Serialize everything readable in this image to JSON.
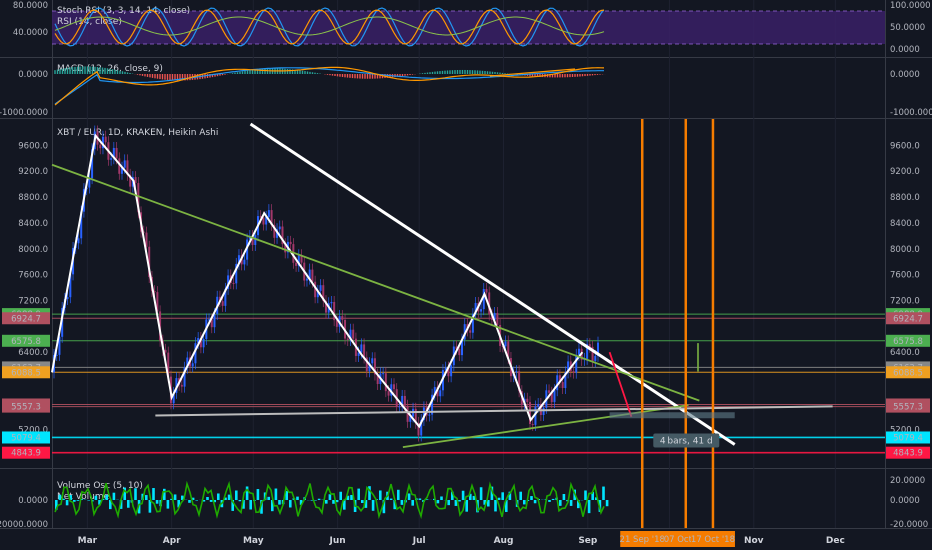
{
  "chart_data": {
    "type": "candlestick",
    "title": "XBT / EUR, 1D, KRAKEN, Heikin Ashi",
    "x_months": [
      "Mar",
      "Apr",
      "May",
      "Jun",
      "Jul",
      "Aug",
      "Sep",
      "Oct",
      "Nov",
      "Dec"
    ],
    "date_marker_labels": [
      "21 Sep '18",
      "07 Oct '18",
      "17 Oct '18"
    ],
    "price_axis": {
      "ticks": [
        9600,
        9200,
        8800,
        8400,
        8000,
        7600,
        7200,
        6400,
        5200
      ],
      "ylim": [
        4700,
        9900
      ],
      "left_ticks": [
        9600,
        9200,
        8800,
        8400,
        8000,
        7600,
        7200,
        6400,
        5200
      ]
    },
    "horizontal_levels": [
      {
        "value": "6988.9",
        "color": "#4caf50"
      },
      {
        "value": "6924.7",
        "color": "#b05060"
      },
      {
        "value": "6575.8",
        "color": "#4caf50"
      },
      {
        "value": "6163.7",
        "color": "#888888"
      },
      {
        "value": "6088.5",
        "color": "#f0a020"
      },
      {
        "value": "5590.1",
        "color": "#b05060"
      },
      {
        "value": "5557.3",
        "color": "#b05060"
      },
      {
        "value": "5079.4",
        "color": "#00e5ff"
      },
      {
        "value": "4843.9",
        "color": "#ff1744"
      }
    ],
    "price_path": [
      {
        "date": "Feb 16",
        "price": 6088
      },
      {
        "date": "Mar 4",
        "price": 9750
      },
      {
        "date": "Mar 18",
        "price": 9050
      },
      {
        "date": "Apr 1",
        "price": 5700
      },
      {
        "date": "May 5",
        "price": 8550
      },
      {
        "date": "Jun 10",
        "price": 6350
      },
      {
        "date": "Jul 1",
        "price": 5250
      },
      {
        "date": "Jul 25",
        "price": 7300
      },
      {
        "date": "Aug 11",
        "price": 5350
      },
      {
        "date": "Aug 30",
        "price": 6400
      }
    ],
    "trendlines": [
      {
        "name": "white-descending",
        "color": "#ffffff",
        "points": [
          [
            "Apr 30",
            9930
          ],
          [
            "Oct 25",
            4970
          ]
        ]
      },
      {
        "name": "green-descending",
        "color": "#7cb342",
        "points": [
          [
            "Feb 16",
            9300
          ],
          [
            "Oct 12",
            5650
          ]
        ]
      },
      {
        "name": "green-ascending",
        "color": "#7cb342",
        "points": [
          [
            "Jun 25",
            4930
          ],
          [
            "Oct 8",
            5580
          ]
        ]
      },
      {
        "name": "grey-support",
        "color": "#bdbdbd",
        "points": [
          [
            "Mar 26",
            5420
          ],
          [
            "Nov 30",
            5560
          ]
        ]
      },
      {
        "name": "red-segment",
        "color": "#ff1744",
        "points": [
          [
            "Sep 9",
            6400
          ],
          [
            "Sep 17",
            5400
          ]
        ]
      }
    ],
    "stoch_rsi": {
      "label": "Stoch RSI (3, 3, 14, 14, close)",
      "rsi_label": "RSI (14, close)",
      "left_ticks": [
        "80.0000",
        "40.0000"
      ],
      "right_ticks": [
        "100.0000",
        "50.0000",
        "0.0000"
      ]
    },
    "macd": {
      "label": "MACD (12, 26, close, 9)",
      "left_ticks": [
        "0.0000",
        "-1000.0000"
      ],
      "right_ticks": [
        "0.0000",
        "-1000.0000"
      ]
    },
    "oscillator": {
      "label": "Volume Osc (5, 10)",
      "net_label": "Net Volume",
      "left_ticks": [
        "0.0000",
        "-20000.0000"
      ],
      "right_ticks": [
        "20.0000",
        "0.0000",
        "-20.0000"
      ]
    },
    "bars_label": "4 bars, 41 d"
  }
}
